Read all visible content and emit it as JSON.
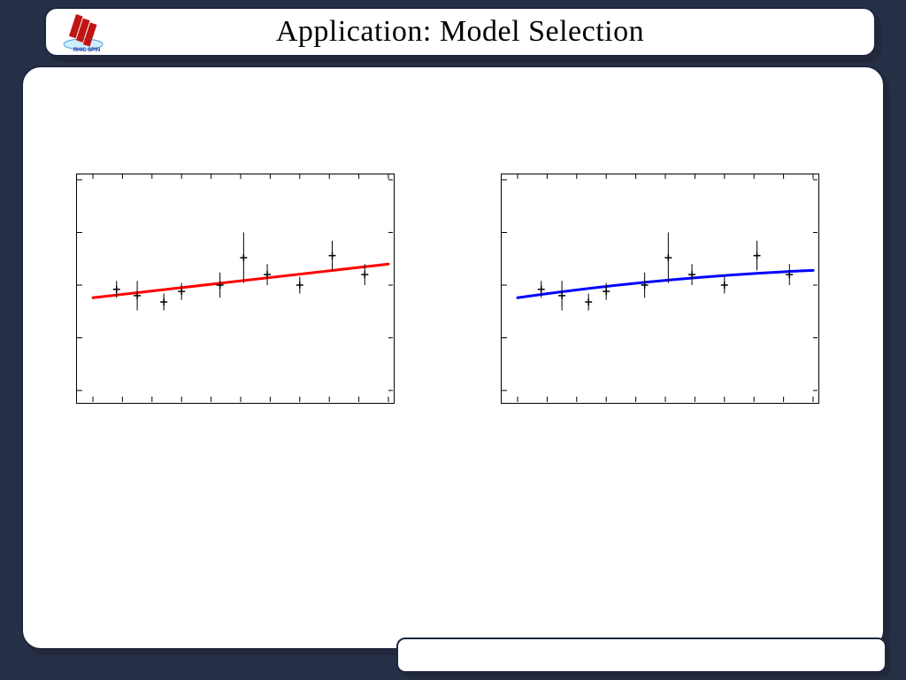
{
  "title": "Application: Model Selection",
  "footer": "",
  "logo_label": "RHIC SPIN",
  "chart_data": [
    {
      "type": "scatter",
      "title": "",
      "xlabel": "",
      "ylabel": "",
      "xlim": [
        0,
        10
      ],
      "ylim": [
        0,
        1.0
      ],
      "x_ticks": [
        0,
        1,
        2,
        3,
        4,
        5,
        6,
        7,
        8,
        9,
        10
      ],
      "y_ticks": [
        0,
        0.25,
        0.5,
        0.75,
        1.0
      ],
      "points": [
        {
          "x": 0.8,
          "y": 0.48,
          "err": 0.04
        },
        {
          "x": 1.5,
          "y": 0.45,
          "err": 0.07
        },
        {
          "x": 2.4,
          "y": 0.42,
          "err": 0.04
        },
        {
          "x": 3.0,
          "y": 0.47,
          "err": 0.04
        },
        {
          "x": 4.3,
          "y": 0.5,
          "err": 0.06
        },
        {
          "x": 5.1,
          "y": 0.63,
          "err": 0.12
        },
        {
          "x": 5.9,
          "y": 0.55,
          "err": 0.05
        },
        {
          "x": 7.0,
          "y": 0.5,
          "err": 0.04
        },
        {
          "x": 8.1,
          "y": 0.64,
          "err": 0.07
        },
        {
          "x": 9.2,
          "y": 0.55,
          "err": 0.05
        }
      ],
      "fit": {
        "kind": "linear",
        "color": "#ff0000",
        "y_start": 0.44,
        "y_end": 0.6
      }
    },
    {
      "type": "scatter",
      "title": "",
      "xlabel": "",
      "ylabel": "",
      "xlim": [
        0,
        10
      ],
      "ylim": [
        0,
        1.0
      ],
      "x_ticks": [
        0,
        1,
        2,
        3,
        4,
        5,
        6,
        7,
        8,
        9,
        10
      ],
      "y_ticks": [
        0,
        0.25,
        0.5,
        0.75,
        1.0
      ],
      "points": [
        {
          "x": 0.8,
          "y": 0.48,
          "err": 0.04
        },
        {
          "x": 1.5,
          "y": 0.45,
          "err": 0.07
        },
        {
          "x": 2.4,
          "y": 0.42,
          "err": 0.04
        },
        {
          "x": 3.0,
          "y": 0.47,
          "err": 0.04
        },
        {
          "x": 4.3,
          "y": 0.5,
          "err": 0.06
        },
        {
          "x": 5.1,
          "y": 0.63,
          "err": 0.12
        },
        {
          "x": 5.9,
          "y": 0.55,
          "err": 0.05
        },
        {
          "x": 7.0,
          "y": 0.5,
          "err": 0.04
        },
        {
          "x": 8.1,
          "y": 0.64,
          "err": 0.07
        },
        {
          "x": 9.2,
          "y": 0.55,
          "err": 0.05
        }
      ],
      "fit": {
        "kind": "saturating",
        "color": "#0000ff",
        "y_start": 0.44,
        "y_mid": 0.54,
        "y_end": 0.57
      }
    }
  ]
}
